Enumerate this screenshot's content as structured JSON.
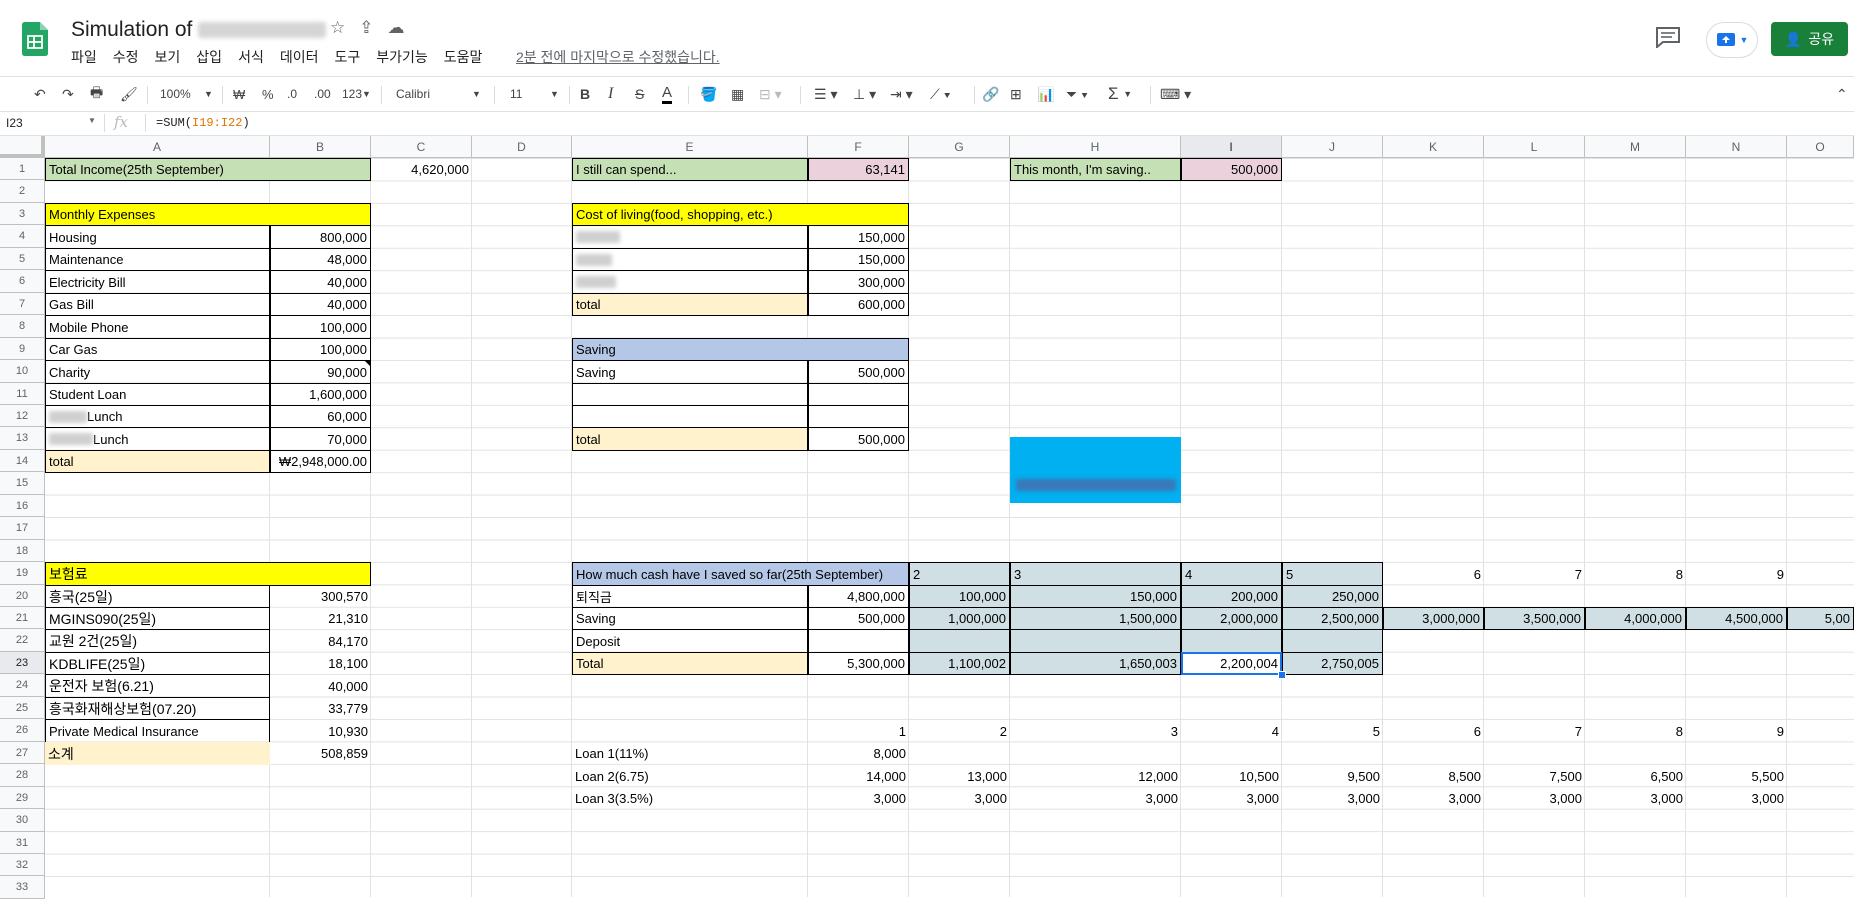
{
  "doc": {
    "title_prefix": "Simulation of",
    "menus": [
      "파일",
      "수정",
      "보기",
      "삽입",
      "서식",
      "데이터",
      "도구",
      "부가기능",
      "도움말"
    ],
    "last_edit": "2분 전에 마지막으로 수정했습니다.",
    "share_label": "공유"
  },
  "toolbar": {
    "zoom": "100%",
    "currency": "₩",
    "percent": "%",
    "dec_dec": ".0",
    "dec_inc": ".00",
    "format_more": "123",
    "font": "Calibri",
    "font_size": "11",
    "bold": "B",
    "italic": "I",
    "strike": "S",
    "text_color": "A",
    "sum": "Σ"
  },
  "formula_bar": {
    "name_box": "I23",
    "fx": "fx",
    "formula_prefix": "=SUM(",
    "formula_range": "I19:I22",
    "formula_suffix": ")"
  },
  "columns": [
    "A",
    "B",
    "C",
    "D",
    "E",
    "F",
    "G",
    "H",
    "I",
    "J",
    "K",
    "L",
    "M",
    "N",
    "O"
  ],
  "rows": [
    "1",
    "2",
    "3",
    "4",
    "5",
    "6",
    "7",
    "8",
    "9",
    "10",
    "11",
    "12",
    "13",
    "14",
    "15",
    "16",
    "17",
    "18",
    "19",
    "20",
    "21",
    "22",
    "23",
    "24",
    "25",
    "26",
    "27",
    "28",
    "29",
    "30",
    "31",
    "32",
    "33"
  ],
  "sheet": {
    "income_label": "Total Income(25th September)",
    "income_value": "4,620,000",
    "spend_label": "I still can spend...",
    "spend_value": "63,141",
    "saving_month_label": "This month, I'm saving..",
    "saving_month_value": "500,000",
    "monthly_header": "Monthly Expenses",
    "expenses": [
      {
        "label": "Housing",
        "value": "800,000"
      },
      {
        "label": "Maintenance",
        "value": "48,000"
      },
      {
        "label": "Electricity Bill",
        "value": "40,000"
      },
      {
        "label": "Gas Bill",
        "value": "40,000"
      },
      {
        "label": "Mobile Phone",
        "value": "100,000"
      },
      {
        "label": "Car Gas",
        "value": "100,000"
      },
      {
        "label": "Charity",
        "value": "90,000"
      },
      {
        "label": "Student Loan",
        "value": "1,600,000"
      },
      {
        "label": "Lunch",
        "value": "60,000"
      },
      {
        "label": "Lunch",
        "value": "70,000"
      }
    ],
    "expenses_total_label": "total",
    "expenses_total_value": "₩2,948,000.00",
    "col_header": "Cost of living(food, shopping, etc.)",
    "col_values": [
      "150,000",
      "150,000",
      "300,000"
    ],
    "col_total_label": "total",
    "col_total_value": "600,000",
    "saving_header": "Saving",
    "saving_label": "Saving",
    "saving_value": "500,000",
    "saving_total_label": "total",
    "saving_total_value": "500,000",
    "insurance_header": "보험료",
    "insurance": [
      {
        "label": "흥국(25일)",
        "value": "300,570"
      },
      {
        "label": "MGINS090(25일)",
        "value": "21,310"
      },
      {
        "label": "교원 2건(25일)",
        "value": "84,170"
      },
      {
        "label": "KDBLIFE(25일)",
        "value": "18,100"
      },
      {
        "label": "운전자 보험(6.21)",
        "value": "40,000"
      },
      {
        "label": "흥국화재해상보험(07.20)",
        "value": "33,779"
      },
      {
        "label": "Private Medical Insurance",
        "value": "10,930"
      }
    ],
    "insurance_total_label": "소계",
    "insurance_total_value": "508,859",
    "cash_header": "How much cash have I saved so far(25th September)",
    "cash_cols": [
      "2",
      "3",
      "4",
      "5",
      "6",
      "7",
      "8",
      "9"
    ],
    "cash_rows": [
      {
        "label": "퇴직금",
        "values": [
          "4,800,000",
          "100,000",
          "150,000",
          "200,000",
          "250,000",
          "",
          "",
          "",
          "",
          ""
        ]
      },
      {
        "label": "Saving",
        "values": [
          "500,000",
          "1,000,000",
          "1,500,000",
          "2,000,000",
          "2,500,000",
          "3,000,000",
          "3,500,000",
          "4,000,000",
          "4,500,000",
          "5,00"
        ]
      },
      {
        "label": "Deposit",
        "values": [
          "",
          "",
          "",
          "",
          "",
          "",
          "",
          "",
          "",
          ""
        ]
      },
      {
        "label": "Total",
        "values": [
          "5,300,000",
          "1,100,002",
          "1,650,003",
          "2,200,004",
          "2,750,005",
          "",
          "",
          "",
          "",
          ""
        ]
      }
    ],
    "loan_cols": [
      "1",
      "2",
      "3",
      "4",
      "5",
      "6",
      "7",
      "8",
      "9"
    ],
    "loans": [
      {
        "label": "Loan 1(11%)",
        "values": [
          "8,000",
          "",
          "",
          "",
          "",
          "",
          "",
          "",
          ""
        ]
      },
      {
        "label": "Loan 2(6.75)",
        "values": [
          "14,000",
          "13,000",
          "12,000",
          "10,500",
          "9,500",
          "8,500",
          "7,500",
          "6,500",
          "5,500"
        ]
      },
      {
        "label": "Loan 3(3.5%)",
        "values": [
          "3,000",
          "3,000",
          "3,000",
          "3,000",
          "3,000",
          "3,000",
          "3,000",
          "3,000",
          "3,000"
        ]
      }
    ]
  },
  "colors": {
    "green": "#c5e0b4",
    "pink": "#ead1dc",
    "yellow": "#ffff00",
    "cream": "#fff2cc",
    "blue": "#b4c7e7",
    "teal": "#d0dfe3",
    "sheets_green": "#188038",
    "cyan_block": "#00b0f0"
  }
}
